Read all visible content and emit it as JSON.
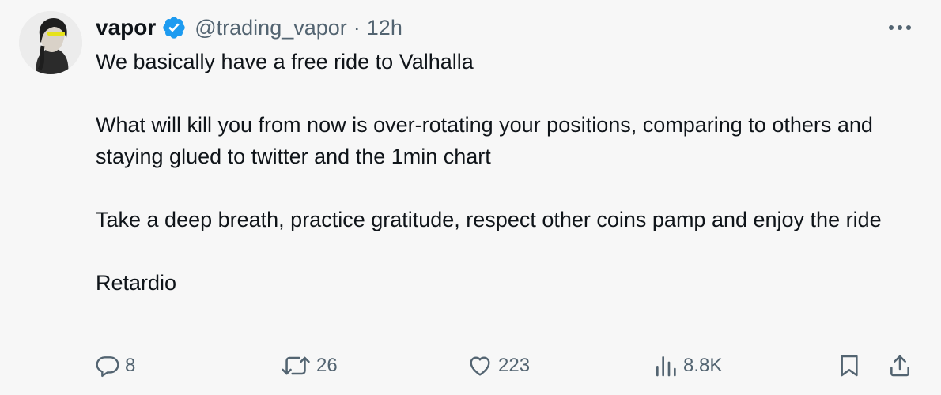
{
  "tweet": {
    "author_name": "vapor",
    "handle": "@trading_vapor",
    "separator": "·",
    "time": "12h",
    "paragraphs": [
      "We basically have a free ride to Valhalla",
      "What will kill you from now is over-rotating your positions, comparing to others and staying glued to twitter and the 1min chart",
      "Take a deep breath, practice gratitude, respect other coins pamp and enjoy the ride",
      "Retardio"
    ]
  },
  "actions": {
    "replies": "8",
    "reposts": "26",
    "likes": "223",
    "views": "8.8K"
  },
  "icons": {
    "verified": "verified-badge-icon",
    "more": "more-dots-icon",
    "reply": "reply-bubble-icon",
    "repost": "repost-arrows-icon",
    "like": "heart-icon",
    "views": "views-bars-icon",
    "bookmark": "bookmark-icon",
    "share": "share-upload-icon"
  },
  "colors": {
    "background": "#f7f7f7",
    "text": "#0f1419",
    "muted": "#536471",
    "verified": "#1d9bf0",
    "avatar_accent": "#e6e21a"
  }
}
